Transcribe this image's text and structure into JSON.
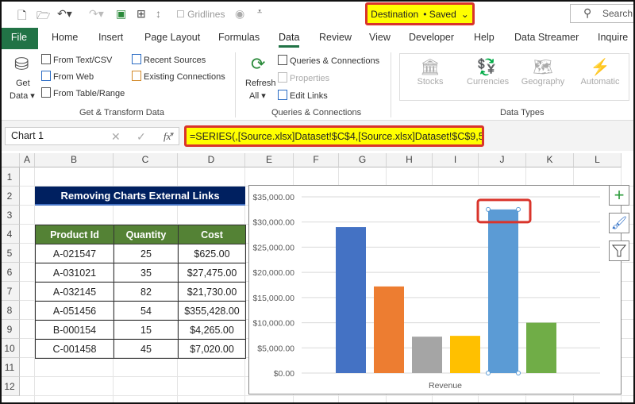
{
  "title_bar": {
    "gridlines_label": "Gridlines",
    "doc_name": "Destination",
    "saved_status": "• Saved",
    "search_placeholder": "Search"
  },
  "tabs": [
    "File",
    "Home",
    "Insert",
    "Page Layout",
    "Formulas",
    "Data",
    "Review",
    "View",
    "Developer",
    "Help",
    "Data Streamer",
    "Inquire"
  ],
  "ribbon": {
    "get_data": "Get",
    "get_data2": "Data",
    "from_text": "From Text/CSV",
    "from_web": "From Web",
    "from_table": "From Table/Range",
    "recent_sources": "Recent Sources",
    "existing_connections": "Existing Connections",
    "group1": "Get & Transform Data",
    "refresh": "Refresh",
    "refresh2": "All",
    "queries_connections": "Queries & Connections",
    "properties": "Properties",
    "edit_links": "Edit Links",
    "group2": "Queries & Connections",
    "stocks": "Stocks",
    "currencies": "Currencies",
    "geography": "Geography",
    "automatic": "Automatic",
    "group3": "Data Types"
  },
  "formula_bar": {
    "name_box": "Chart 1",
    "formula": "=SERIES(,[Source.xlsx]Dataset!$C$4,[Source.xlsx]Dataset!$C$9,5"
  },
  "columns": [
    "A",
    "B",
    "C",
    "D",
    "E",
    "F",
    "G",
    "H",
    "I",
    "J",
    "K",
    "L"
  ],
  "rows": [
    "1",
    "2",
    "3",
    "4",
    "5",
    "6",
    "7",
    "8",
    "9",
    "10",
    "11",
    "12"
  ],
  "sheet": {
    "title": "Removing Charts External Links",
    "headers": [
      "Product Id",
      "Quantity",
      "Cost"
    ],
    "rows": [
      [
        "A-021547",
        "25",
        "$625.00"
      ],
      [
        "A-031021",
        "35",
        "$27,475.00"
      ],
      [
        "A-032145",
        "82",
        "$21,730.00"
      ],
      [
        "A-051456",
        "54",
        "$355,428.00"
      ],
      [
        "B-000154",
        "15",
        "$4,265.00"
      ],
      [
        "C-001458",
        "45",
        "$7,020.00"
      ]
    ]
  },
  "chart_data": {
    "type": "bar",
    "xlabel": "Revenue",
    "ylim": [
      0,
      35000
    ],
    "y_ticks": [
      "$0.00",
      "$5,000.00",
      "$10,000.00",
      "$15,000.00",
      "$20,000.00",
      "$25,000.00",
      "$30,000.00",
      "$35,000.00"
    ],
    "values": [
      29000,
      17200,
      7230,
      7390,
      32500,
      10000
    ],
    "colors": [
      "#4472c4",
      "#ed7d31",
      "#a5a5a5",
      "#ffc000",
      "#5b9bd5",
      "#70ad47"
    ],
    "selected_index": 4
  }
}
